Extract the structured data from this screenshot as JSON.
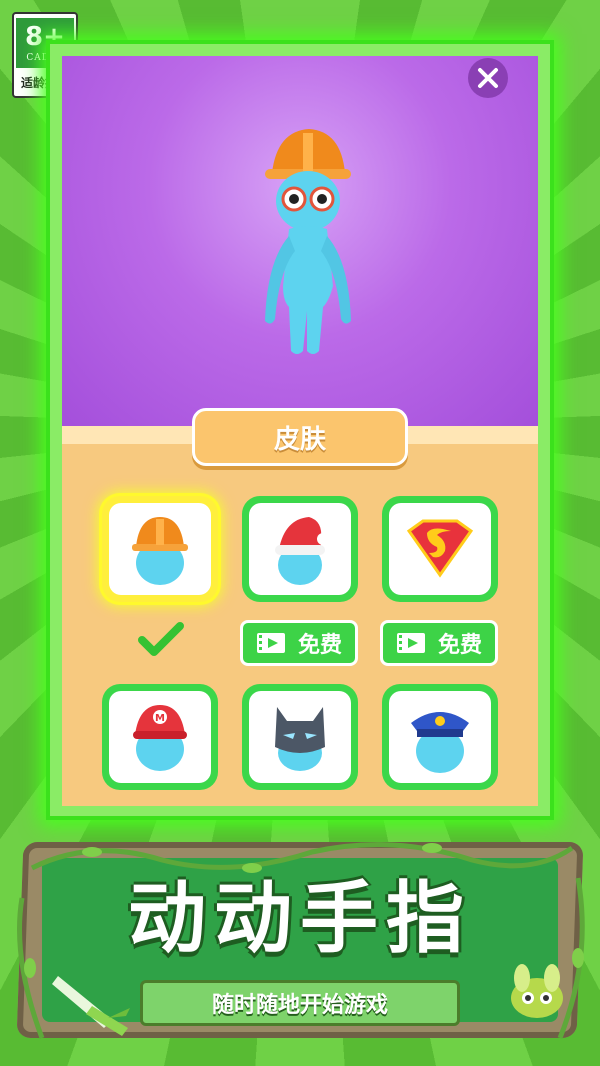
{
  "age_rating": {
    "number": "8+",
    "org": "CADPA",
    "label": "适龄提示"
  },
  "close_icon": "close-icon",
  "skin_tab": {
    "label": "皮肤"
  },
  "items": [
    {
      "id": "hard-hat",
      "icon": "hard-hat-icon",
      "selected": true,
      "status": "owned"
    },
    {
      "id": "santa-hat",
      "icon": "santa-hat-icon",
      "selected": false,
      "status": "free"
    },
    {
      "id": "superman",
      "icon": "superman-logo-icon",
      "selected": false,
      "status": "free"
    },
    {
      "id": "mario-cap",
      "icon": "mario-cap-icon",
      "selected": false,
      "status": "locked"
    },
    {
      "id": "batman-mask",
      "icon": "batman-mask-icon",
      "selected": false,
      "status": "locked"
    },
    {
      "id": "police-cap",
      "icon": "police-cap-icon",
      "selected": false,
      "status": "locked"
    }
  ],
  "free_buttons": {
    "label_1": "免费",
    "label_2": "免费"
  },
  "banner": {
    "title": "动动手指",
    "subtitle": "随时随地开始游戏"
  },
  "colors": {
    "accent_green": "#3dd347",
    "stage_purple": "#a44fdb",
    "floor_orange": "#f7c97f"
  }
}
